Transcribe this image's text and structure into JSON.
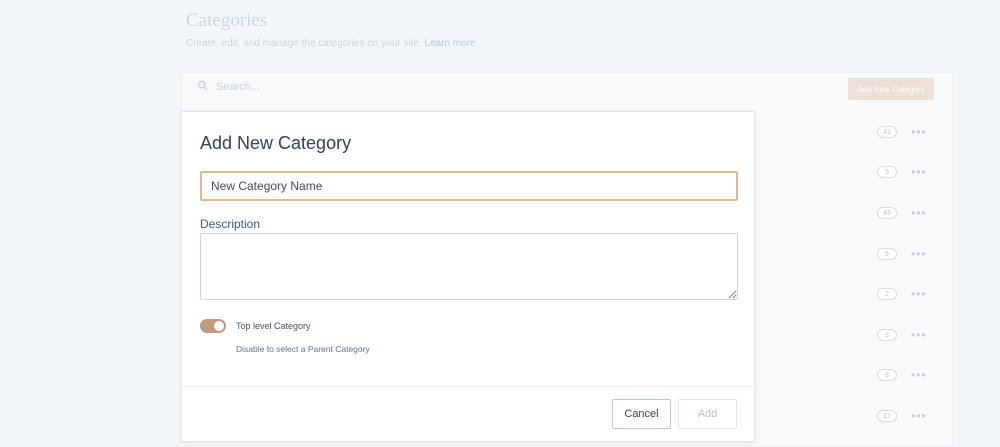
{
  "background": {
    "title": "Categories",
    "subtitle": "Create, edit, and manage the categories on your site.",
    "subtitle_link": "Learn more",
    "search_placeholder": "Search...",
    "add_button": "Add New Category",
    "row_counts": [
      "42",
      "9",
      "43",
      "6",
      "2",
      "3",
      "8",
      "17"
    ]
  },
  "dialog": {
    "title": "Add New Category",
    "name_placeholder": "New Category Name",
    "name_value": "",
    "description_label": "Description",
    "description_value": "",
    "toggle_on": true,
    "toggle_label": "Top level Category",
    "toggle_help": "Disable to select a Parent Category",
    "cancel_label": "Cancel",
    "add_label": "Add"
  },
  "colors": {
    "accent": "#c19a80",
    "input_focus_border": "#e0b898",
    "text": "#2e4453"
  }
}
